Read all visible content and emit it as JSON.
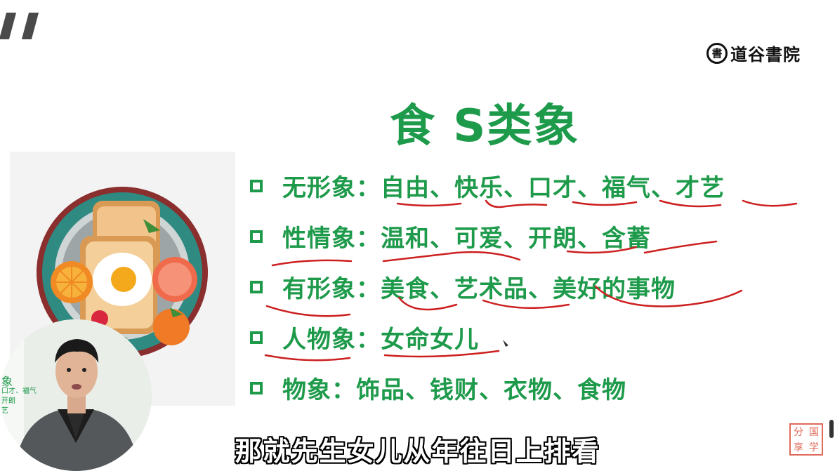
{
  "brand": {
    "seal": "書",
    "name": "道谷書院"
  },
  "slide": {
    "title": "食 S类象",
    "items": [
      {
        "label": "无形象",
        "sep": "：",
        "content": "自由、快乐、口才、福气、才艺"
      },
      {
        "label": "性情象",
        "sep": "：",
        "content": "温和、可爱、开朗、含蓄"
      },
      {
        "label": "有形象",
        "sep": "：",
        "content": "美食、艺术品、美好的事物"
      },
      {
        "label": "人物象",
        "sep": "：",
        "content": "女命女儿"
      },
      {
        "label": "物象",
        "sep": "：",
        "content": "饰品、钱财、衣物、食物"
      }
    ],
    "illustration": "breakfast-plate-illustration"
  },
  "webcam": {
    "partial_slide_text": [
      "象",
      "口才、福气",
      "开朗",
      "艺"
    ]
  },
  "subtitle": "那就先生女儿从年往日上排看",
  "stamp": {
    "chars": [
      "分",
      "国",
      "享",
      "学"
    ]
  },
  "colors": {
    "accent": "#1e9a4b",
    "ink": "#cc1f1f",
    "stamp": "#e06a5a"
  }
}
